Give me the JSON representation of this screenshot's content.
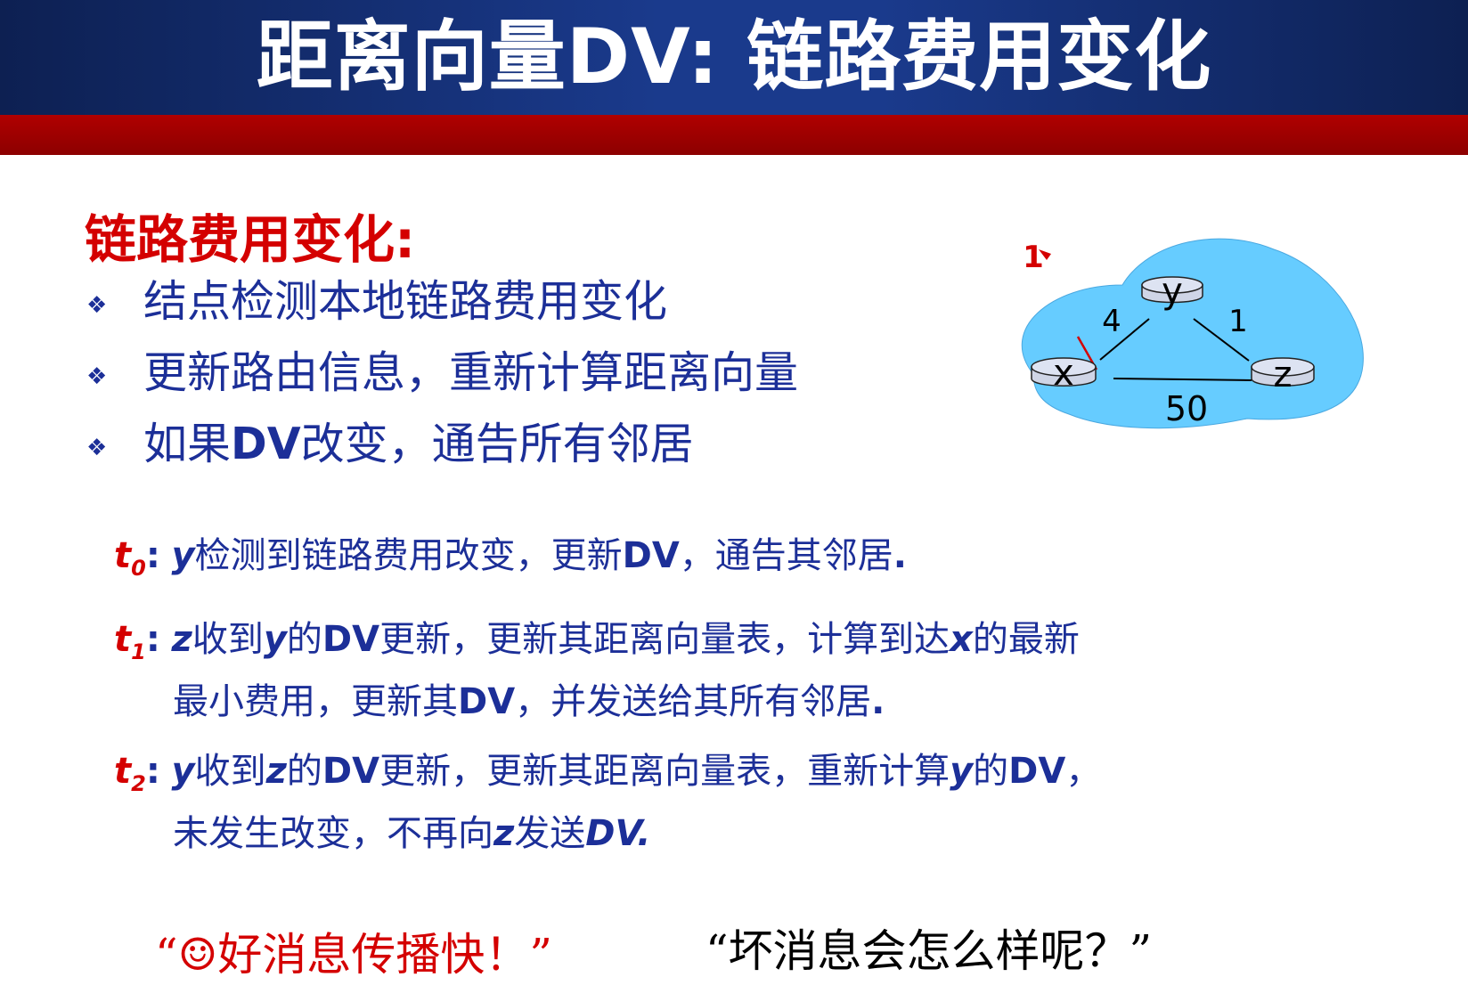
{
  "slide": {
    "title": "距离向量DV: 链路费用变化",
    "heading": "链路费用变化:",
    "bullets": [
      {
        "mark": "❖",
        "pre": "结点检测本地链路费用变化",
        "bold": "",
        "post": ""
      },
      {
        "mark": "❖",
        "pre": "更新路由信息，重新计算距离向量",
        "bold": "",
        "post": ""
      },
      {
        "mark": "❖",
        "pre": "如果",
        "bold": "DV",
        "post": "改变，通告所有邻居"
      }
    ],
    "events": {
      "t0": {
        "label": "t",
        "sub": "0",
        "colon": ":",
        "n1": "y",
        "s1": "检测到链路费用改变，更新",
        "n2": "DV",
        "s2": "，通告其邻居",
        "end": "."
      },
      "t1": {
        "label": "t",
        "sub": "1",
        "colon": ":",
        "n1": "z",
        "s1": "收到",
        "n2": "y",
        "s2": "的",
        "n3": "DV",
        "s3": "更新，更新其距离向量表，计算到达",
        "n4": "x",
        "s4": "的最新",
        "line2_pre": "最小费用，更新其",
        "line2_dv": "DV",
        "line2_post": "，并发送给其所有邻居",
        "line2_end": "."
      },
      "t2": {
        "label": "t",
        "sub": "2",
        "colon": ":",
        "n1": "y",
        "s1": "收到",
        "n2": "z",
        "s2": "的",
        "n3": "DV",
        "s3": "更新，更新其距离向量表，重新计算",
        "n4": "y",
        "s4": "的",
        "n5": "DV",
        "s5": "，",
        "line2_pre": "未发生改变，不再向",
        "line2_z": "z",
        "line2_mid": "发送",
        "line2_dv": "DV."
      }
    },
    "quotes": {
      "good": "“☺好消息传播快！”",
      "bad": "“坏消息会怎么样呢？”"
    },
    "network": {
      "nodes": {
        "x": "x",
        "y": "y",
        "z": "z"
      },
      "costs": {
        "xy_old": "4",
        "xy_new": "1",
        "yz": "1",
        "xz": "50"
      }
    },
    "colors": {
      "title_bg": "#1a3a8c",
      "band": "#9b0000",
      "text_blue": "#1c2f98",
      "accent_red": "#d40000",
      "cloud": "#66ccff"
    }
  }
}
